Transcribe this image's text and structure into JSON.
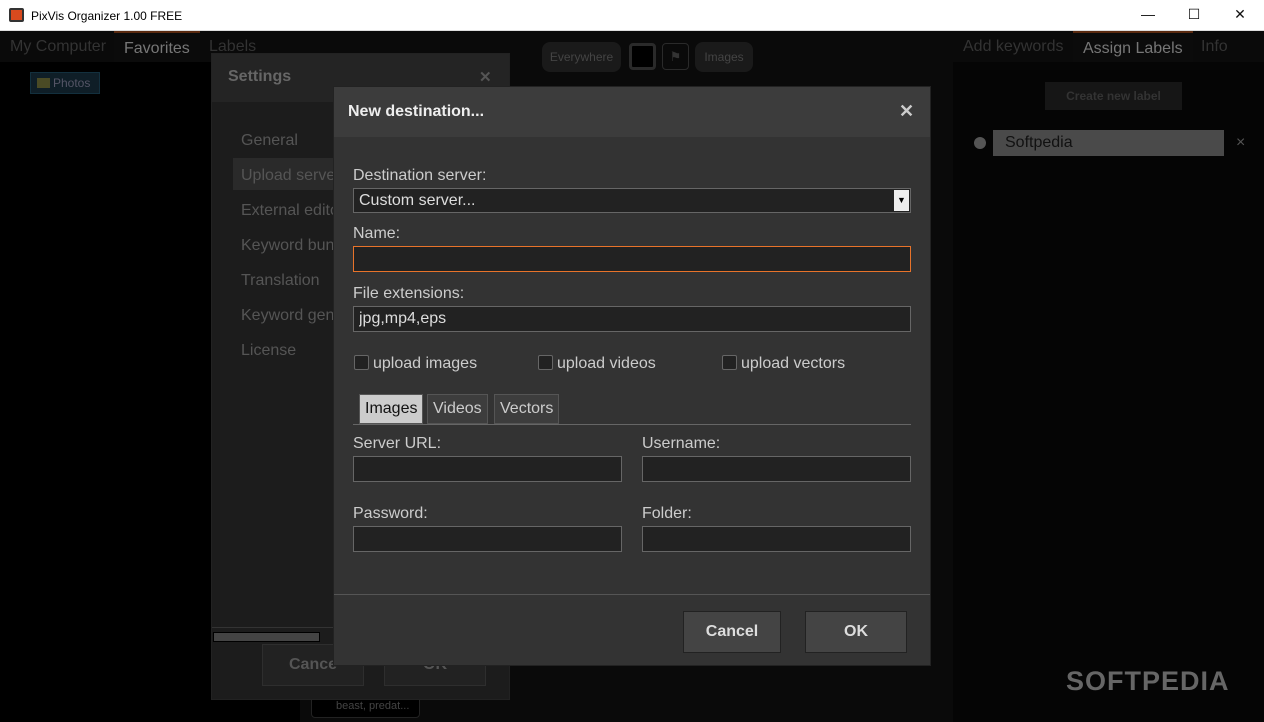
{
  "window": {
    "title": "PixVis Organizer 1.00 FREE",
    "minimize": "—",
    "maximize": "☐",
    "close": "✕"
  },
  "left_tabs": [
    {
      "label": "My Computer"
    },
    {
      "label": "Favorites",
      "active": true
    },
    {
      "label": "Labels"
    }
  ],
  "tree": {
    "item": "Photos"
  },
  "toolbar": {
    "everywhere": "Everywhere",
    "images": "Images"
  },
  "right_tabs": [
    {
      "label": "Add keywords"
    },
    {
      "label": "Assign Labels",
      "active": true
    },
    {
      "label": "Info"
    }
  ],
  "labels": {
    "create": "Create new label",
    "items": [
      {
        "name": "Softpedia"
      }
    ],
    "remove": "×"
  },
  "thumb": {
    "keywords": "beast, predat..."
  },
  "settings": {
    "title": "Settings",
    "close": "✕",
    "items": [
      "General",
      "Upload serve",
      "External edito",
      "Keyword bun",
      "Translation",
      "Keyword gen",
      "License"
    ],
    "selected": 1,
    "cancel": "Cance",
    "ok": "OK"
  },
  "dialog": {
    "title": "New destination...",
    "close": "✕",
    "destination_label": "Destination server:",
    "destination_value": "Custom server...",
    "name_label": "Name:",
    "name_value": "",
    "ext_label": "File extensions:",
    "ext_value": "jpg,mp4,eps",
    "checkboxes": [
      {
        "label": "upload images",
        "checked": false
      },
      {
        "label": "upload videos",
        "checked": false
      },
      {
        "label": "upload vectors",
        "checked": false
      }
    ],
    "tabs": [
      {
        "label": "Images",
        "active": true
      },
      {
        "label": "Videos"
      },
      {
        "label": "Vectors"
      }
    ],
    "server_url_label": "Server URL:",
    "username_label": "Username:",
    "password_label": "Password:",
    "folder_label": "Folder:",
    "cancel": "Cancel",
    "ok": "OK"
  },
  "watermark": "SOFTPEDIA",
  "colors": {
    "accent": "#e8732a",
    "dialog_bg": "#333333"
  }
}
